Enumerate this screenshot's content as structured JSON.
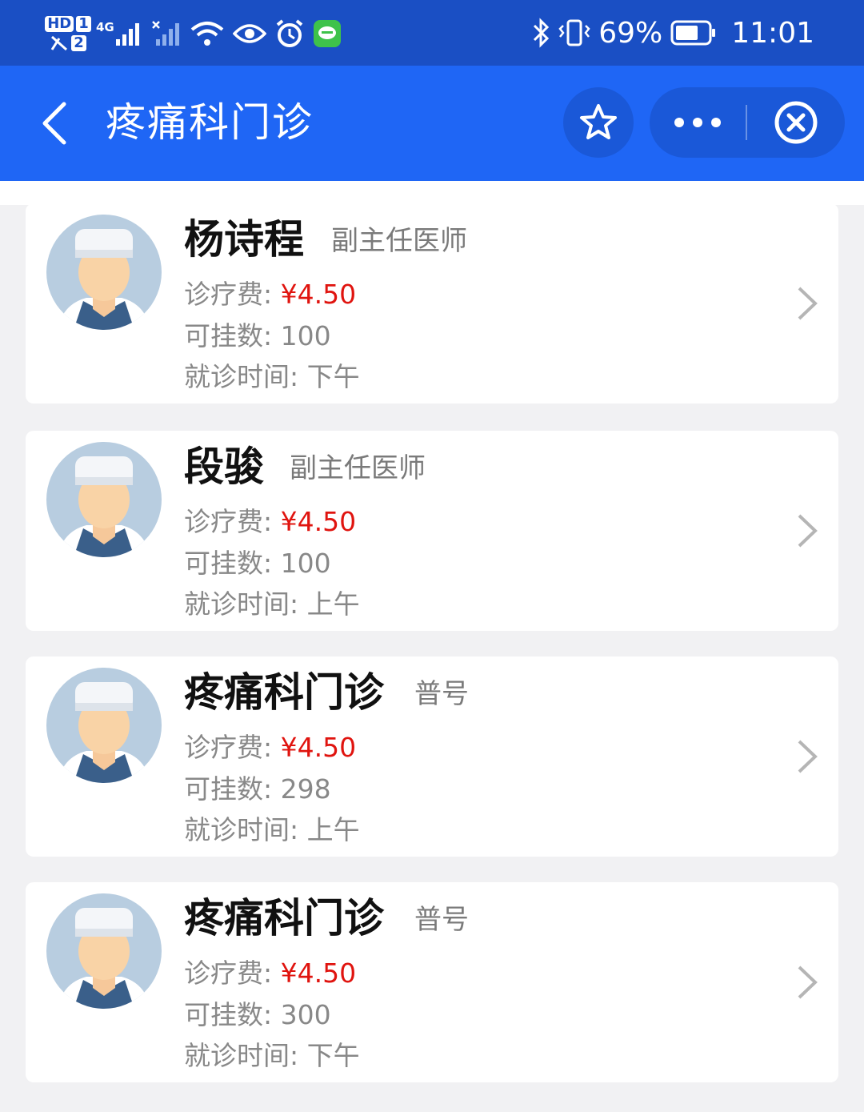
{
  "status_bar": {
    "hd1": "HD",
    "sim1": "1",
    "net": "4G",
    "sim2": "2",
    "battery_percent": "69%",
    "time": "11:01",
    "icons": [
      "hd-icon",
      "signal-icon",
      "wifi-icon",
      "eye-icon",
      "alarm-icon",
      "chat-app-icon",
      "bluetooth-icon",
      "vibrate-icon",
      "battery-icon"
    ]
  },
  "nav": {
    "title": "疼痛科门诊",
    "icons": [
      "back-arrow-icon",
      "star-icon",
      "more-dots-icon",
      "close-circle-icon"
    ]
  },
  "labels": {
    "fee": "诊疗费:",
    "count": "可挂数:",
    "time": "就诊时间:"
  },
  "doctors": [
    {
      "name": "杨诗程",
      "title": "副主任医师",
      "fee": "¥4.50",
      "count": "100",
      "time": "下午"
    },
    {
      "name": "段骏",
      "title": "副主任医师",
      "fee": "¥4.50",
      "count": "100",
      "time": "上午"
    },
    {
      "name": "疼痛科门诊",
      "title": "普号",
      "fee": "¥4.50",
      "count": "298",
      "time": "上午"
    },
    {
      "name": "疼痛科门诊",
      "title": "普号",
      "fee": "¥4.50",
      "count": "300",
      "time": "下午"
    }
  ],
  "colors": {
    "status_bar_bg": "#1a4fc4",
    "nav_bg": "#1f66f5",
    "price": "#e0140f",
    "page_bg": "#f1f1f3"
  }
}
